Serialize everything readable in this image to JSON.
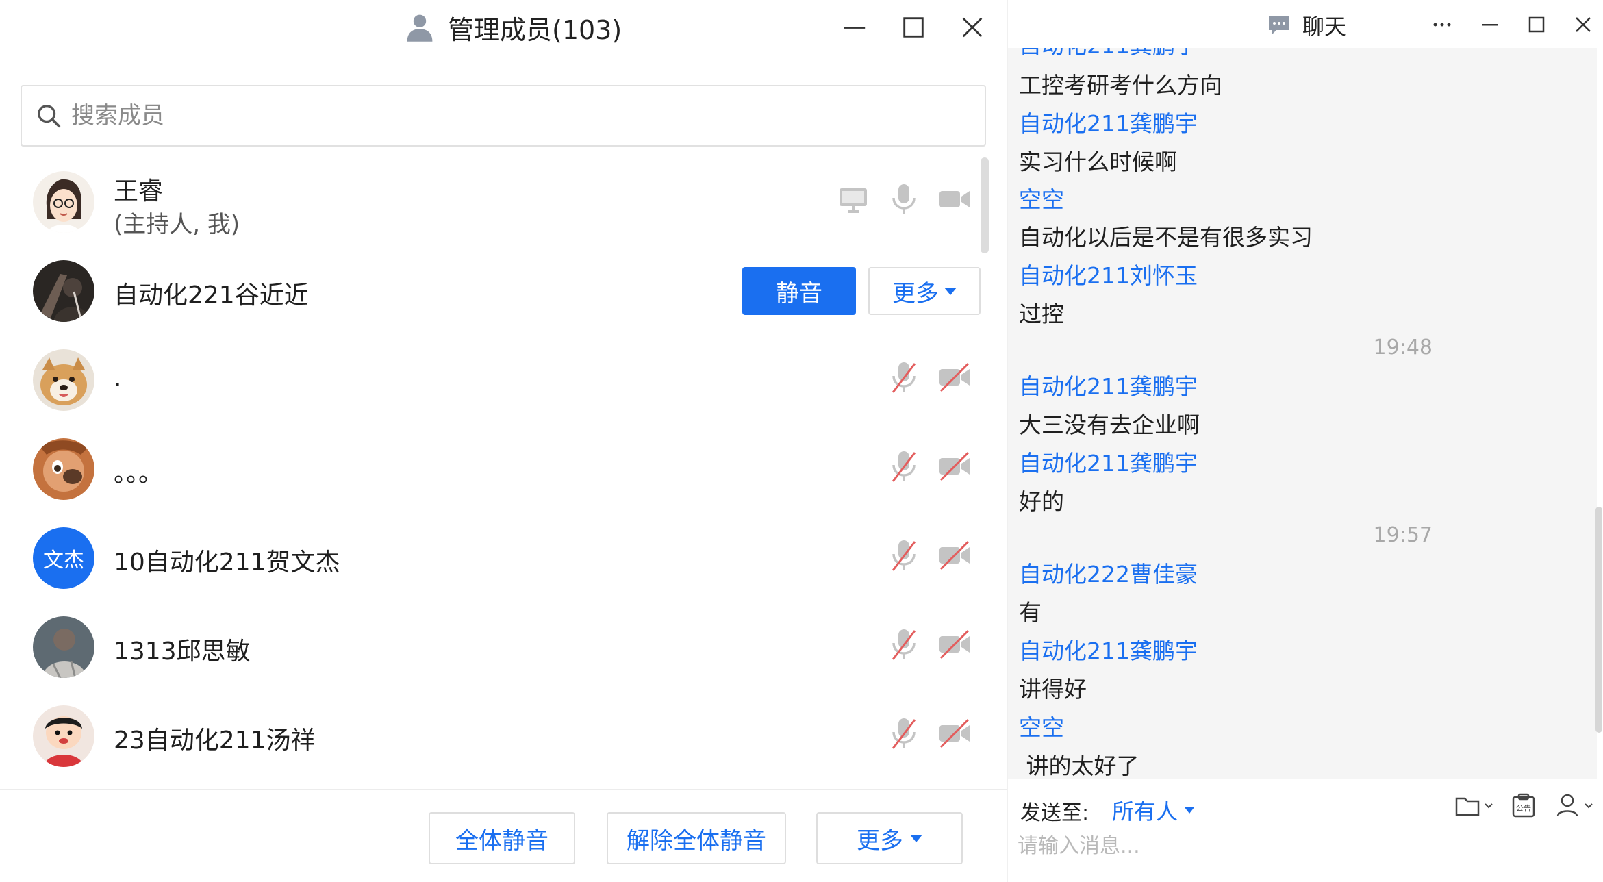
{
  "members_window": {
    "title": "管理成员(103)",
    "search_placeholder": "搜索成员",
    "members": [
      {
        "name": "王睿",
        "sub": "(主持人, 我)"
      },
      {
        "name": "自动化221谷近近",
        "mute_label": "静音",
        "more_label": "更多"
      },
      {
        "name": "."
      },
      {
        "name": "。。。"
      },
      {
        "name": "10自动化211贺文杰",
        "avatar_text": "文杰"
      },
      {
        "name": "1313邱思敏"
      },
      {
        "name": "23自动化211汤祥"
      }
    ],
    "footer": {
      "mute_all": "全体静音",
      "unmute_all": "解除全体静音",
      "more": "更多"
    }
  },
  "chat_window": {
    "title": "聊天",
    "messages": [
      {
        "type": "text",
        "value": "工控考研考什么方向"
      },
      {
        "type": "sender",
        "value": "自动化211龚鹏宇"
      },
      {
        "type": "text",
        "value": "实习什么时候啊"
      },
      {
        "type": "sender",
        "value": "空空"
      },
      {
        "type": "text",
        "value": "自动化以后是不是有很多实习"
      },
      {
        "type": "sender",
        "value": "自动化211刘怀玉"
      },
      {
        "type": "text",
        "value": "过控"
      },
      {
        "type": "time",
        "value": "19:48"
      },
      {
        "type": "sender",
        "value": "自动化211龚鹏宇"
      },
      {
        "type": "text",
        "value": "大三没有去企业啊"
      },
      {
        "type": "sender",
        "value": "自动化211龚鹏宇"
      },
      {
        "type": "text",
        "value": "好的"
      },
      {
        "type": "time",
        "value": "19:57"
      },
      {
        "type": "sender",
        "value": "自动化222曹佳豪"
      },
      {
        "type": "text",
        "value": "有"
      },
      {
        "type": "sender",
        "value": "自动化211龚鹏宇"
      },
      {
        "type": "text",
        "value": "讲得好"
      },
      {
        "type": "sender",
        "value": "空空"
      },
      {
        "type": "text",
        "value": " 讲的太好了"
      }
    ],
    "compose": {
      "send_to_label": "发送至:",
      "send_to_value": "所有人",
      "placeholder": "请输入消息..."
    }
  },
  "colors": {
    "accent": "#1a6ff0",
    "muted_red": "#e35d5d",
    "icon_gray": "#c4c4c4"
  }
}
